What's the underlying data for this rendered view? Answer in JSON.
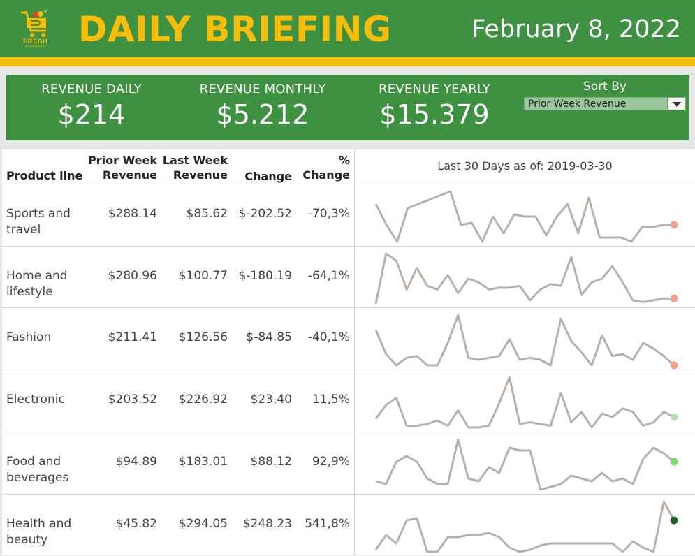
{
  "header": {
    "logo_text": "FRESH",
    "logo_sub": "SUPERMARKET",
    "title": "DAILY BRIEFING",
    "date": "February 8, 2022"
  },
  "kpis": [
    {
      "label": "REVENUE DAILY",
      "value": "$214"
    },
    {
      "label": "REVENUE MONTHLY",
      "value": "$5.212"
    },
    {
      "label": "REVENUE YEARLY",
      "value": "$15.379"
    }
  ],
  "sort": {
    "label": "Sort By",
    "value": "Prior Week Revenue"
  },
  "table": {
    "headers": {
      "product_line": "Product line",
      "prior_week_1": "Prior Week",
      "prior_week_2": "Revenue",
      "last_week_1": "Last Week",
      "last_week_2": "Revenue",
      "change": "Change",
      "pct_1": "%",
      "pct_2": "Change"
    },
    "spark_title": "Last 30 Days as of: 2019-03-30",
    "rows": [
      {
        "product_line_1": "Sports and",
        "product_line_2": "travel",
        "prior": "$288.14",
        "last": "$85.62",
        "change": "$-202.52",
        "pct": "-70,3%",
        "dot_color": "#f0a090",
        "spark": [
          20,
          10,
          2,
          18,
          20,
          22,
          24,
          26,
          10,
          11,
          2,
          14,
          6,
          15,
          14,
          14,
          5,
          14,
          20,
          6,
          23,
          4,
          4,
          4,
          2,
          9,
          9,
          10,
          10
        ]
      },
      {
        "product_line_1": "Home and",
        "product_line_2": "lifestyle",
        "prior": "$280.96",
        "last": "$100.77",
        "change": "$-180.19",
        "pct": "-64,1%",
        "dot_color": "#f0a090",
        "spark": [
          2,
          30,
          26,
          10,
          22,
          12,
          10,
          18,
          8,
          16,
          14,
          10,
          11,
          11,
          12,
          4,
          10,
          13,
          12,
          28,
          7,
          14,
          16,
          23,
          14,
          4,
          3,
          4,
          5,
          5
        ]
      },
      {
        "product_line_1": "Fashion",
        "product_line_2": "",
        "prior": "$211.41",
        "last": "$126.56",
        "change": "$-84.85",
        "pct": "-40,1%",
        "dot_color": "#f0a090",
        "spark": [
          20,
          7,
          1,
          5,
          6,
          1,
          1,
          13,
          28,
          5,
          4,
          5,
          6,
          15,
          4,
          5,
          4,
          1,
          26,
          14,
          8,
          1,
          17,
          6,
          7,
          4,
          13,
          10,
          6,
          1
        ]
      },
      {
        "product_line_1": "Electronic",
        "product_line_2": "",
        "prior": "$203.52",
        "last": "$226.92",
        "change": "$23.40",
        "pct": "11,5%",
        "dot_color": "#bcd9b4",
        "spark": [
          6,
          14,
          18,
          2,
          2,
          3,
          5,
          2,
          11,
          1,
          1,
          2,
          15,
          30,
          3,
          4,
          3,
          2,
          21,
          4,
          10,
          1,
          9,
          7,
          12,
          10,
          2,
          4,
          10,
          7
        ]
      },
      {
        "product_line_1": "Food and",
        "product_line_2": "beverages",
        "prior": "$94.89",
        "last": "$183.01",
        "change": "$88.12",
        "pct": "92,9%",
        "dot_color": "#7fd46e",
        "spark": [
          3,
          2,
          10,
          12,
          10,
          4,
          2,
          2,
          18,
          4,
          3,
          8,
          6,
          15,
          14,
          14,
          0,
          1,
          2,
          5,
          4,
          3,
          6,
          3,
          4,
          2,
          11,
          15,
          13,
          10
        ]
      },
      {
        "product_line_1": "Health and",
        "product_line_2": "beauty",
        "prior": "$45.82",
        "last": "$294.05",
        "change": "$248.23",
        "pct": "541,8%",
        "dot_color": "#1f5e2e",
        "spark": [
          2,
          9,
          5,
          16,
          17,
          1,
          1,
          8,
          8,
          9,
          9,
          10,
          8,
          3,
          1,
          2,
          4,
          5,
          5,
          5,
          5,
          5,
          5,
          5,
          1,
          6,
          3,
          1,
          25,
          16
        ]
      }
    ]
  }
}
